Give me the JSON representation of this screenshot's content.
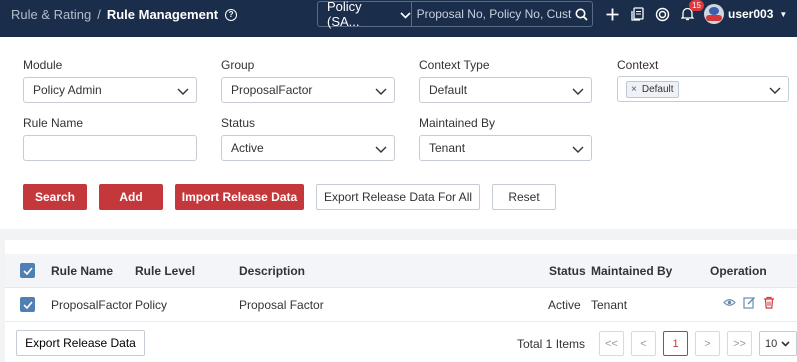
{
  "header": {
    "breadcrumb_parent": "Rule & Rating",
    "breadcrumb_sep": "/",
    "breadcrumb_current": "Rule Management",
    "search_type": "Policy (SA...",
    "search_placeholder": "Proposal No, Policy No, Cust",
    "notification_count": "15",
    "username": "user003"
  },
  "filters": {
    "module": {
      "label": "Module",
      "value": "Policy Admin"
    },
    "group": {
      "label": "Group",
      "value": "ProposalFactor"
    },
    "context_type": {
      "label": "Context Type",
      "value": "Default"
    },
    "context": {
      "label": "Context",
      "tag": "Default",
      "tag_remove": "×"
    },
    "rule_name": {
      "label": "Rule Name",
      "value": ""
    },
    "status": {
      "label": "Status",
      "value": "Active"
    },
    "maintained_by": {
      "label": "Maintained By",
      "value": "Tenant"
    }
  },
  "actions": {
    "search": "Search",
    "add": "Add",
    "import": "Import Release Data",
    "export_all": "Export Release Data For All",
    "reset": "Reset"
  },
  "table": {
    "columns": {
      "rule_name": "Rule Name",
      "rule_level": "Rule Level",
      "description": "Description",
      "status": "Status",
      "maintained_by": "Maintained By",
      "operation": "Operation"
    },
    "rows": [
      {
        "rule_name": "ProposalFactor",
        "rule_level": "Policy",
        "description": "Proposal Factor",
        "status": "Active",
        "maintained_by": "Tenant"
      }
    ]
  },
  "footer": {
    "export_button": "Export Release Data",
    "total": "Total 1 Items",
    "first": "<<",
    "prev": "<",
    "page": "1",
    "next": ">",
    "last": ">>",
    "page_size": "10"
  },
  "colors": {
    "topbar": "#1a2d4a",
    "accent_red": "#c4383c",
    "checkbox_blue": "#4f7fb3"
  }
}
